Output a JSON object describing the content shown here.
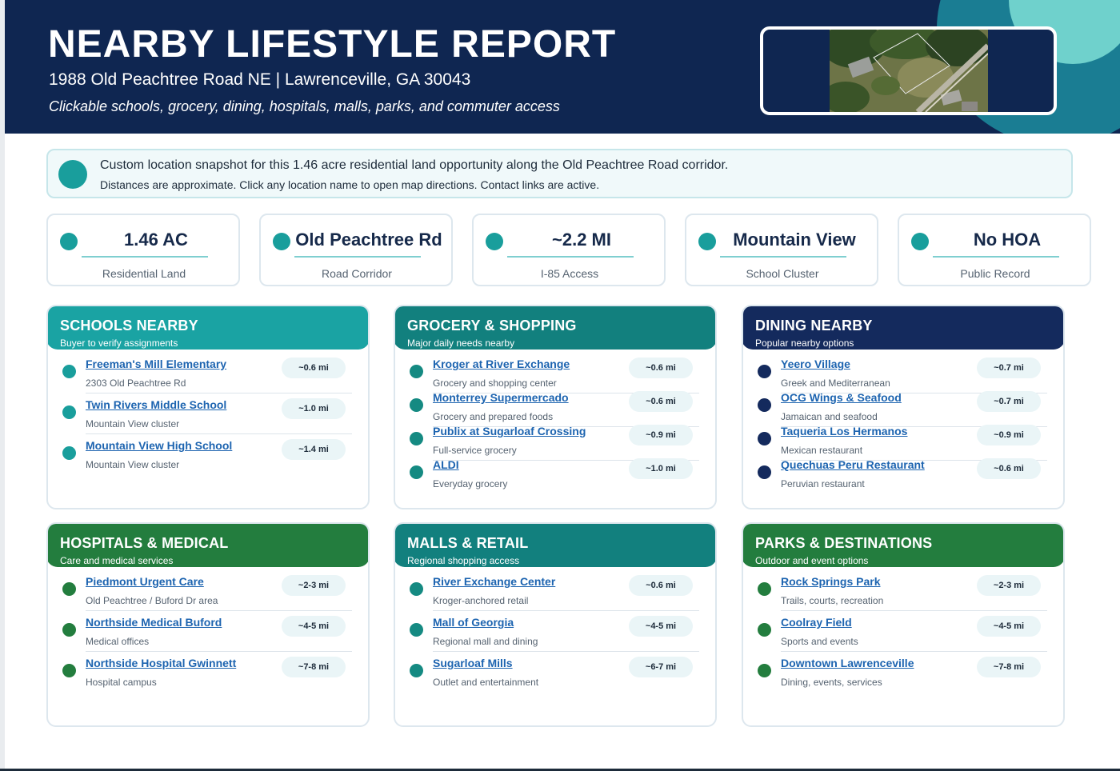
{
  "header": {
    "title": "NEARBY LIFESTYLE REPORT",
    "address": "1988 Old Peachtree Road NE  |  Lawrenceville, GA 30043",
    "tagline": "Clickable schools, grocery, dining, hospitals, malls, parks, and commuter access",
    "photo_icon": "aerial-property-photo"
  },
  "notice": {
    "line1": "Custom location snapshot for this 1.46 acre residential land opportunity along the Old Peachtree Road corridor.",
    "line2": "Distances are approximate. Click any location name to open map directions. Contact links are active."
  },
  "stats": [
    {
      "value": "1.46 AC",
      "label": "Residential Land"
    },
    {
      "value": "Old Peachtree Rd",
      "label": "Road Corridor"
    },
    {
      "value": "~2.2 MI",
      "label": "I-85 Access"
    },
    {
      "value": "Mountain View",
      "label": "School Cluster"
    },
    {
      "value": "No HOA",
      "label": "Public Record"
    }
  ],
  "sections": {
    "schools": {
      "title": "SCHOOLS NEARBY",
      "subtitle": "Buyer to verify assignments",
      "items": [
        {
          "name": "Freeman's Mill Elementary",
          "desc": "2303 Old Peachtree Rd",
          "dist": "~0.6 mi"
        },
        {
          "name": "Twin Rivers Middle School",
          "desc": "Mountain View cluster",
          "dist": "~1.0 mi"
        },
        {
          "name": "Mountain View High School",
          "desc": "Mountain View cluster",
          "dist": "~1.4 mi"
        }
      ]
    },
    "grocery": {
      "title": "GROCERY & SHOPPING",
      "subtitle": "Major daily needs nearby",
      "items": [
        {
          "name": "Kroger at River Exchange",
          "desc": "Grocery and shopping center",
          "dist": "~0.6 mi"
        },
        {
          "name": "Monterrey Supermercado",
          "desc": "Grocery and prepared foods",
          "dist": "~0.6 mi"
        },
        {
          "name": "Publix at Sugarloaf Crossing",
          "desc": "Full-service grocery",
          "dist": "~0.9 mi"
        },
        {
          "name": "ALDI",
          "desc": "Everyday grocery",
          "dist": "~1.0 mi"
        }
      ]
    },
    "dining": {
      "title": "DINING NEARBY",
      "subtitle": "Popular nearby options",
      "items": [
        {
          "name": "Yeero Village",
          "desc": "Greek and Mediterranean",
          "dist": "~0.7 mi"
        },
        {
          "name": "OCG Wings & Seafood",
          "desc": "Jamaican and seafood",
          "dist": "~0.7 mi"
        },
        {
          "name": "Taqueria Los Hermanos",
          "desc": "Mexican restaurant",
          "dist": "~0.9 mi"
        },
        {
          "name": "Quechuas Peru Restaurant",
          "desc": "Peruvian restaurant",
          "dist": "~0.6 mi"
        }
      ]
    },
    "hospitals": {
      "title": "HOSPITALS & MEDICAL",
      "subtitle": "Care and medical services",
      "items": [
        {
          "name": "Piedmont Urgent Care",
          "desc": "Old Peachtree / Buford Dr area",
          "dist": "~2-3 mi"
        },
        {
          "name": "Northside Medical Buford",
          "desc": "Medical offices",
          "dist": "~4-5 mi"
        },
        {
          "name": "Northside Hospital Gwinnett",
          "desc": "Hospital campus",
          "dist": "~7-8 mi"
        }
      ]
    },
    "malls": {
      "title": "MALLS & RETAIL",
      "subtitle": "Regional shopping access",
      "items": [
        {
          "name": "River Exchange Center",
          "desc": "Kroger-anchored retail",
          "dist": "~0.6 mi"
        },
        {
          "name": "Mall of Georgia",
          "desc": "Regional mall and dining",
          "dist": "~4-5 mi"
        },
        {
          "name": "Sugarloaf Mills",
          "desc": "Outlet and entertainment",
          "dist": "~6-7 mi"
        }
      ]
    },
    "parks": {
      "title": "PARKS & DESTINATIONS",
      "subtitle": "Outdoor and event options",
      "items": [
        {
          "name": "Rock Springs Park",
          "desc": "Trails, courts, recreation",
          "dist": "~2-3 mi"
        },
        {
          "name": "Coolray Field",
          "desc": "Sports and events",
          "dist": "~4-5 mi"
        },
        {
          "name": "Downtown Lawrenceville",
          "desc": "Dining, events, services",
          "dist": "~7-8 mi"
        }
      ]
    }
  },
  "colors": {
    "header_bg": "#0f2651",
    "teal": "#1aa3a3",
    "dark_teal": "#12807e",
    "navy": "#142a5d",
    "green": "#237d3e",
    "link": "#1d64b0"
  }
}
